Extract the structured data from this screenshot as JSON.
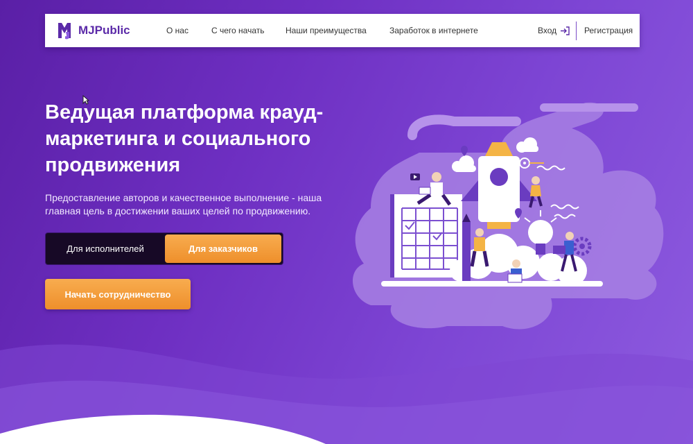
{
  "brand": {
    "name": "MJPublic"
  },
  "nav": {
    "items": [
      {
        "label": "О нас"
      },
      {
        "label": "С чего начать"
      },
      {
        "label": "Наши преимущества"
      },
      {
        "label": "Заработок в интернете"
      }
    ],
    "login_label": "Вход",
    "register_label": "Регистрация"
  },
  "hero": {
    "title": "Ведущая платформа крауд-маркетинга и социального продвижения",
    "subtitle": "Предоставление авторов и качественное выполнение - наша главная цель в достижении ваших целей по продвижению.",
    "toggle": {
      "left_label": "Для исполнителей",
      "right_label": "Для заказчиков",
      "active": "Для заказчиков"
    },
    "cta_label": "Начать сотрудничество"
  },
  "colors": {
    "background": "#6e2fc2",
    "accent_orange": "#f39b3a",
    "brand_purple": "#5b2aa8",
    "illustration_blob": "#a780e3"
  },
  "illustration": {
    "icons": [
      "rocket-icon",
      "cloud-icon",
      "lightbulb-icon",
      "calendar-grid-icon",
      "pencil-icon",
      "location-pin-icon",
      "target-icon",
      "gear-icon",
      "play-icon"
    ],
    "people_count": 5
  }
}
